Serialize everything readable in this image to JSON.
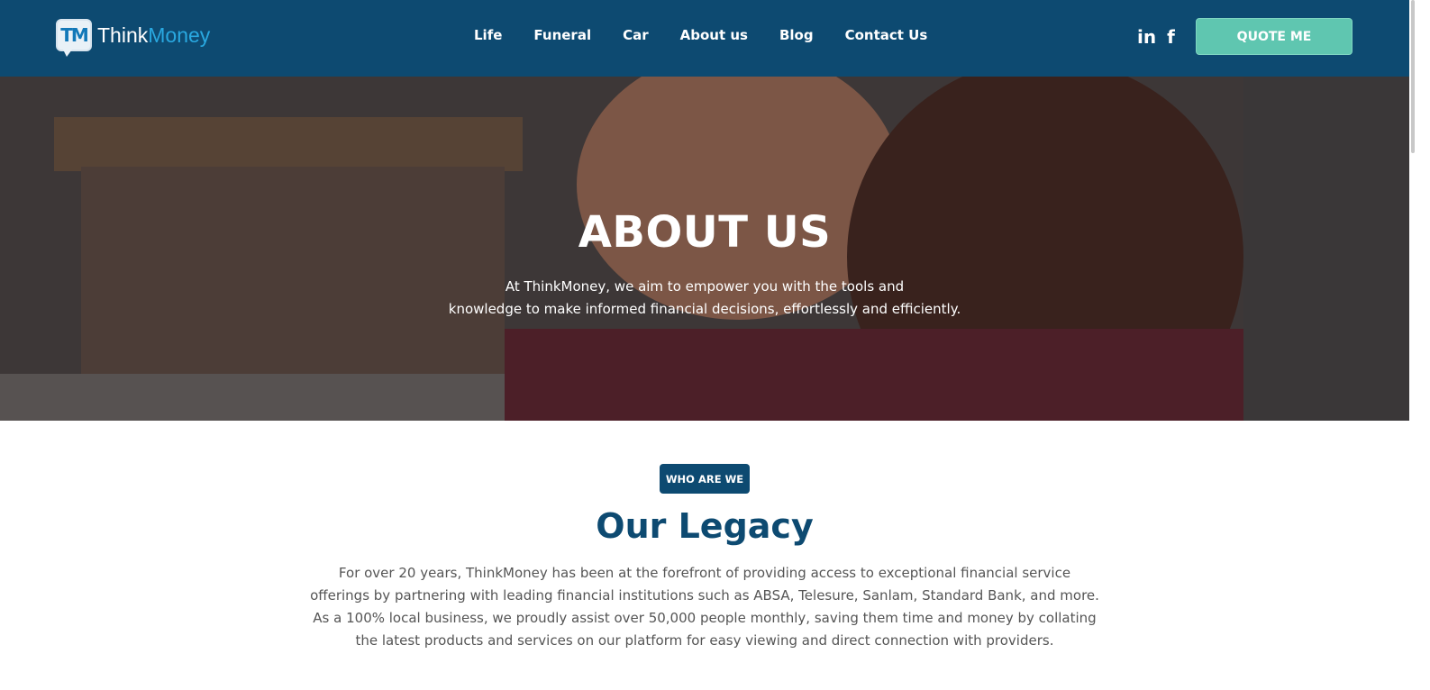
{
  "header": {
    "logo": {
      "mark": "TM",
      "think": "Think",
      "money": "Money"
    },
    "nav": [
      "Life",
      "Funeral",
      "Car",
      "About us",
      "Blog",
      "Contact Us"
    ],
    "social": {
      "linkedin": "in",
      "facebook": "f"
    },
    "quote_button": "QUOTE ME"
  },
  "hero": {
    "title": "ABOUT US",
    "subtitle_line1": "At ThinkMoney, we aim to empower you with the tools and",
    "subtitle_line2": "knowledge to make informed financial decisions, effortlessly and efficiently."
  },
  "legacy": {
    "badge": "WHO ARE WE",
    "title": "Our Legacy",
    "lines": [
      "For over 20 years, ThinkMoney has been at the forefront of providing access to exceptional financial service",
      "offerings by partnering with leading financial institutions such as ABSA, Telesure, Sanlam, Standard Bank, and more.",
      "As a 100% local business, we proudly assist over 50,000 people monthly, saving them time and money by collating",
      "the latest products and services on our platform for easy viewing and direct connection with providers."
    ]
  },
  "colors": {
    "header_bg": "#0d4a71",
    "accent_teal": "#5fc6b0",
    "logo_money": "#29a8e0",
    "heading": "#0d4a71"
  },
  "icons": [
    "linkedin-icon",
    "facebook-icon",
    "logo-mark-icon"
  ]
}
